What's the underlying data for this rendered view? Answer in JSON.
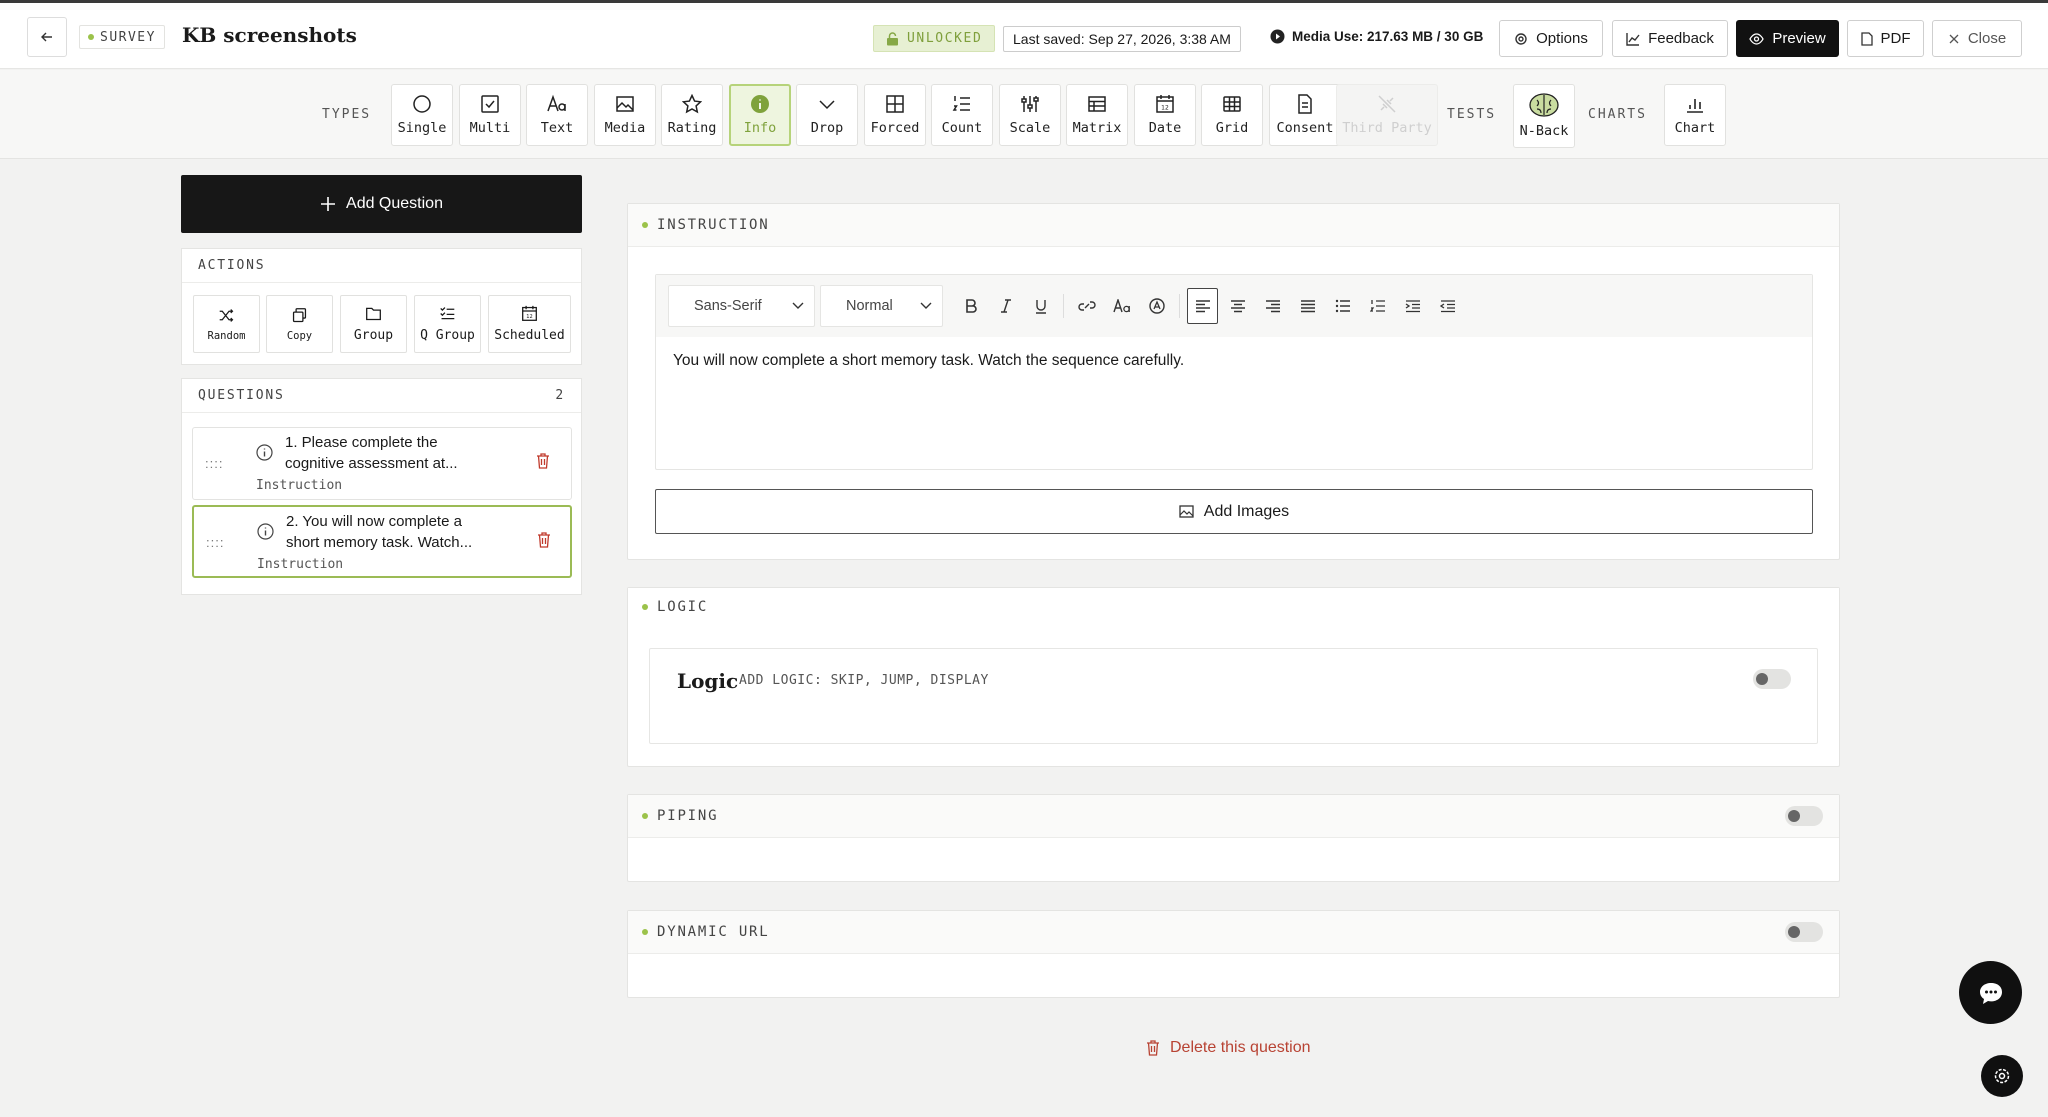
{
  "header": {
    "survey_tag": "SURVEY",
    "title": "KB screenshots",
    "status": "UNLOCKED",
    "last_saved": "Last saved: Sep 27, 2026, 3:38 AM",
    "media_use": "Media Use: 217.63 MB / 30 GB",
    "buttons": {
      "options": "Options",
      "feedback": "Feedback",
      "preview": "Preview",
      "pdf": "PDF",
      "close": "Close"
    }
  },
  "toolbar": {
    "types_label": "TYPES",
    "types": [
      {
        "label": "Single",
        "icon": "circle-icon"
      },
      {
        "label": "Multi",
        "icon": "checkbox-icon"
      },
      {
        "label": "Text",
        "icon": "text-aa-icon"
      },
      {
        "label": "Media",
        "icon": "image-icon"
      },
      {
        "label": "Rating",
        "icon": "star-icon"
      },
      {
        "label": "Info",
        "icon": "info-icon",
        "active": true
      },
      {
        "label": "Drop",
        "icon": "chevron-down-icon"
      },
      {
        "label": "Forced",
        "icon": "grid-icon"
      },
      {
        "label": "Count",
        "icon": "numbered-list-icon"
      },
      {
        "label": "Scale",
        "icon": "sliders-icon"
      },
      {
        "label": "Matrix",
        "icon": "table-icon"
      },
      {
        "label": "Date",
        "icon": "calendar-icon"
      },
      {
        "label": "Grid",
        "icon": "grid-table-icon"
      },
      {
        "label": "Consent",
        "icon": "document-icon"
      },
      {
        "label": "Third Party",
        "icon": "plug-icon",
        "disabled": true
      }
    ],
    "tests_label": "TESTS",
    "tests": [
      {
        "label": "N-Back",
        "icon": "brain-icon"
      }
    ],
    "charts_label": "CHARTS",
    "charts": [
      {
        "label": "Chart",
        "icon": "bar-chart-icon"
      }
    ]
  },
  "left": {
    "add_question": "Add Question",
    "actions_label": "ACTIONS",
    "actions": [
      {
        "label": "Random",
        "icon": "shuffle-icon"
      },
      {
        "label": "Copy",
        "icon": "copy-icon"
      },
      {
        "label": "Group",
        "icon": "folder-icon"
      },
      {
        "label": "Q Group",
        "icon": "list-check-icon"
      },
      {
        "label": "Scheduled",
        "icon": "calendar-icon"
      }
    ],
    "questions_label": "QUESTIONS",
    "questions_count": "2",
    "questions": [
      {
        "text": "1. Please complete the cognitive assessment at...",
        "type": "Instruction"
      },
      {
        "text": "2. You will now complete a short memory task. Watch...",
        "type": "Instruction",
        "selected": true
      }
    ]
  },
  "main": {
    "instruction_label": "INSTRUCTION",
    "font_select": "Sans-Serif",
    "size_select": "Normal",
    "editor_text": "You will now complete a short memory task. Watch the sequence carefully.",
    "add_images": "Add Images",
    "logic_label": "LOGIC",
    "logic_title": "Logic",
    "logic_hint": "ADD LOGIC: SKIP, JUMP, DISPLAY",
    "piping_label": "PIPING",
    "dynamic_url_label": "DYNAMIC URL",
    "delete_question": "Delete this question"
  },
  "colors": {
    "accent": "#9bc24a",
    "danger": "#b84333",
    "dark": "#111111"
  }
}
